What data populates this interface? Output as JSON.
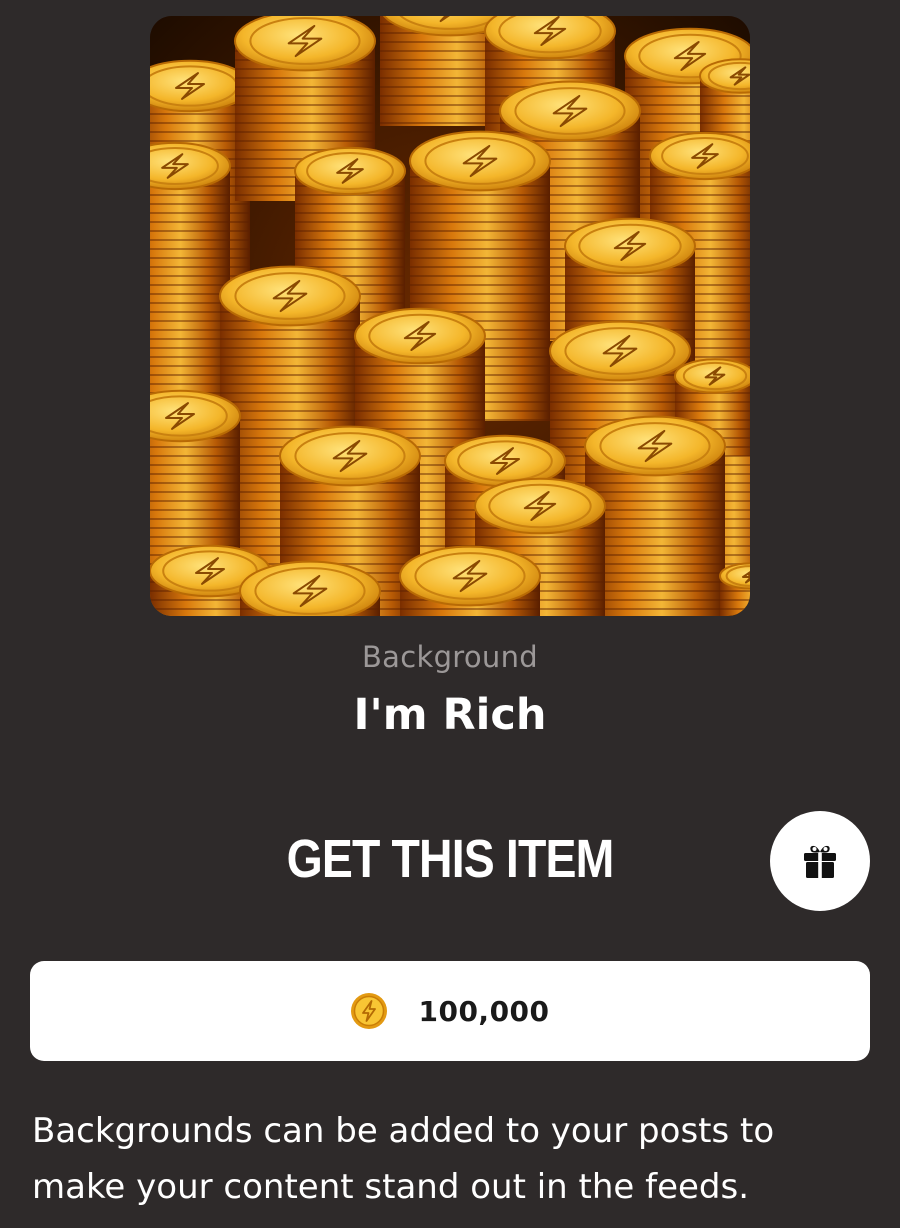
{
  "item": {
    "category": "Background",
    "name": "I'm Rich",
    "preview_icon": "gold-coins-image"
  },
  "actions": {
    "get_item_label": "GET THIS ITEM",
    "gift_icon": "gift-icon"
  },
  "price": {
    "currency_icon": "coin-icon",
    "amount": "100,000"
  },
  "description": "Backgrounds can be added to your posts to make your content stand out in the feeds.",
  "colors": {
    "background": "#2e2a2a",
    "coin_gold": "#f5b21f",
    "card": "#ffffff"
  }
}
